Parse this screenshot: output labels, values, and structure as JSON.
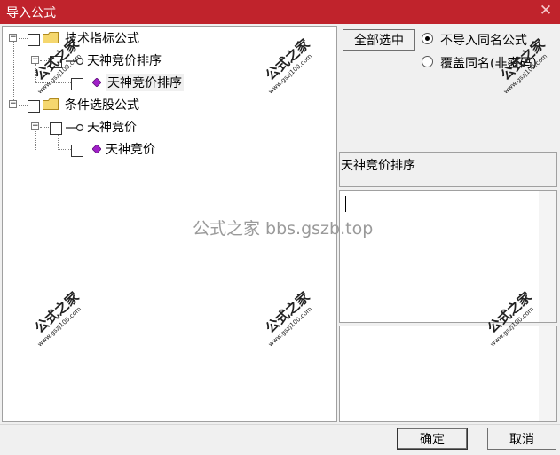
{
  "window": {
    "title": "导入公式",
    "close_glyph": "✕"
  },
  "tree": {
    "nodes": [
      {
        "label": "技术指标公式",
        "checked": false
      },
      {
        "label": "天神竞价排序",
        "checked": false
      },
      {
        "label": "天神竞价排序",
        "checked": false,
        "selected": true
      },
      {
        "label": "条件选股公式",
        "checked": false
      },
      {
        "label": "天神竞价",
        "checked": false
      },
      {
        "label": "天神竞价",
        "checked": false
      }
    ],
    "expand_glyph": "−"
  },
  "actions": {
    "select_all_label": "全部选中",
    "radio_skip_label": "不导入同名公式",
    "radio_overwrite_label": "覆盖同名(非密码)",
    "ok_label": "确定",
    "cancel_label": "取消"
  },
  "detail": {
    "name": "天神竞价排序",
    "formula_text": "",
    "description": ""
  },
  "watermarks": {
    "brand": "公式之家",
    "site": "www.gszj100.com",
    "center": "公式之家 bbs.gszb.top"
  },
  "colors": {
    "titlebar": "#c0232c",
    "gem": "#a020c8",
    "folder": "#f5d76e"
  }
}
